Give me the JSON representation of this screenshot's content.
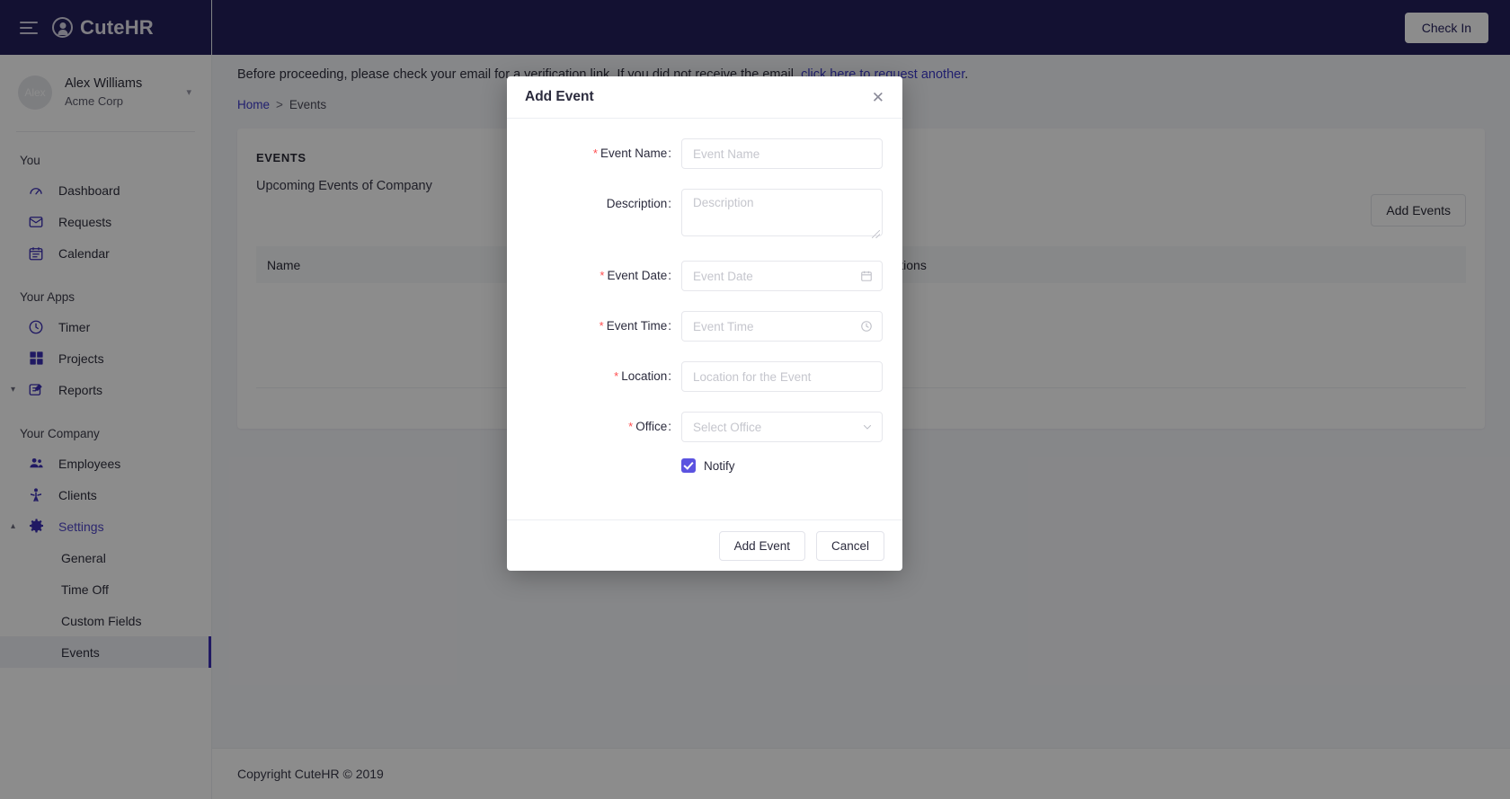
{
  "brand": {
    "name": "CuteHR",
    "logo_icon": "cutehr-logo-icon",
    "menu_icon": "hamburger-collapse-icon"
  },
  "topbar": {
    "check_in_label": "Check In"
  },
  "profile": {
    "avatar_initials": "Alex",
    "name": "Alex Williams",
    "org": "Acme Corp",
    "caret_icon": "chevron-down-icon"
  },
  "sidebar": {
    "groups": [
      {
        "title": "You",
        "items": [
          {
            "label": "Dashboard",
            "icon": "dashboard-gauge-icon"
          },
          {
            "label": "Requests",
            "icon": "envelope-icon"
          },
          {
            "label": "Calendar",
            "icon": "calendar-icon"
          }
        ]
      },
      {
        "title": "Your Apps",
        "items": [
          {
            "label": "Timer",
            "icon": "clock-icon"
          },
          {
            "label": "Projects",
            "icon": "grid-squares-icon"
          },
          {
            "label": "Reports",
            "icon": "report-edit-icon",
            "caret": "chevron-down-icon"
          }
        ]
      },
      {
        "title": "Your Company",
        "items": [
          {
            "label": "Employees",
            "icon": "people-group-icon"
          },
          {
            "label": "Clients",
            "icon": "person-icon"
          },
          {
            "label": "Settings",
            "icon": "gear-icon",
            "caret": "chevron-up-icon"
          },
          {
            "label": "General"
          },
          {
            "label": "Time Off"
          },
          {
            "label": "Custom Fields"
          },
          {
            "label": "Events"
          }
        ]
      }
    ]
  },
  "main": {
    "verification": {
      "text_before": "Before proceeding, please check your email for a verification link. If you did not receive the email, ",
      "link_text": "click here to request another",
      "text_after": "."
    },
    "breadcrumb": {
      "home": "Home",
      "separator": ">",
      "current": "Events"
    },
    "card": {
      "title": "EVENTS",
      "subtitle": "Upcoming Events of Company",
      "add_button": "Add Events",
      "table": {
        "columns": [
          "Name",
          "Actions"
        ]
      }
    },
    "footer": "Copyright CuteHR © 2019"
  },
  "modal": {
    "title": "Add Event",
    "close_icon": "close-x-icon",
    "fields": [
      {
        "label": "Event Name",
        "required": true,
        "placeholder": "Event Name",
        "value": "",
        "type": "text"
      },
      {
        "label": "Description",
        "required": false,
        "placeholder": "Description",
        "value": "",
        "type": "textarea"
      },
      {
        "label": "Event Date",
        "required": true,
        "placeholder": "Event Date",
        "value": "",
        "type": "date",
        "icon": "calendar-icon"
      },
      {
        "label": "Event Time",
        "required": true,
        "placeholder": "Event Time",
        "value": "",
        "type": "time",
        "icon": "clock-icon"
      },
      {
        "label": "Location",
        "required": true,
        "placeholder": "Location for the Event",
        "value": "",
        "type": "text"
      },
      {
        "label": "Office",
        "required": true,
        "placeholder": "Select Office",
        "value": "",
        "type": "select",
        "icon": "chevron-down-icon"
      }
    ],
    "notify": {
      "label": "Notify",
      "checked": true
    },
    "submit_label": "Add Event",
    "cancel_label": "Cancel"
  },
  "colors": {
    "brand_navy": "#241f5c",
    "accent_indigo": "#5b53e0",
    "link_blue": "#3b39c9",
    "required_red": "#ff4d4f",
    "page_bg": "#f5f6fa",
    "selected_item_bg": "#eef0f6"
  }
}
